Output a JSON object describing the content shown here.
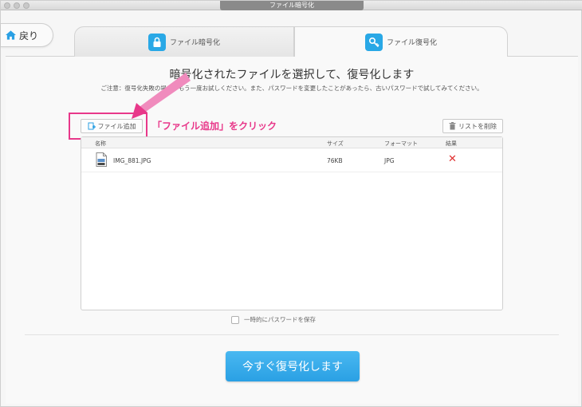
{
  "window": {
    "title": "ファイル暗号化"
  },
  "nav": {
    "back_label": "戻り"
  },
  "tabs": [
    {
      "label": "ファイル暗号化",
      "icon": "lock-icon",
      "active": false
    },
    {
      "label": "ファイル復号化",
      "icon": "key-icon",
      "active": true
    }
  ],
  "main": {
    "heading": "暗号化されたファイルを選択して、復号化します",
    "note": "ご注意：復号化失敗の場合、もう一度お試しください。また、パスワードを変更したことがあったら、古いパスワードで試してみてください。",
    "add_file_label": "ファイル追加",
    "clear_list_label": "リストを削除",
    "annotation": "「ファイル追加」をクリック",
    "save_password_label": "一時的にパスワードを保存",
    "save_password_checked": false,
    "decrypt_label": "今すぐ復号化します"
  },
  "table": {
    "columns": [
      "名称",
      "サイズ",
      "フォーマット",
      "結果"
    ],
    "rows": [
      {
        "name": "IMG_881.JPG",
        "size": "76KB",
        "format": "JPG",
        "result": "✕"
      }
    ]
  },
  "colors": {
    "accent_blue": "#2aa0e4",
    "annotation_pink": "#e8388a",
    "error_red": "#e03030"
  }
}
